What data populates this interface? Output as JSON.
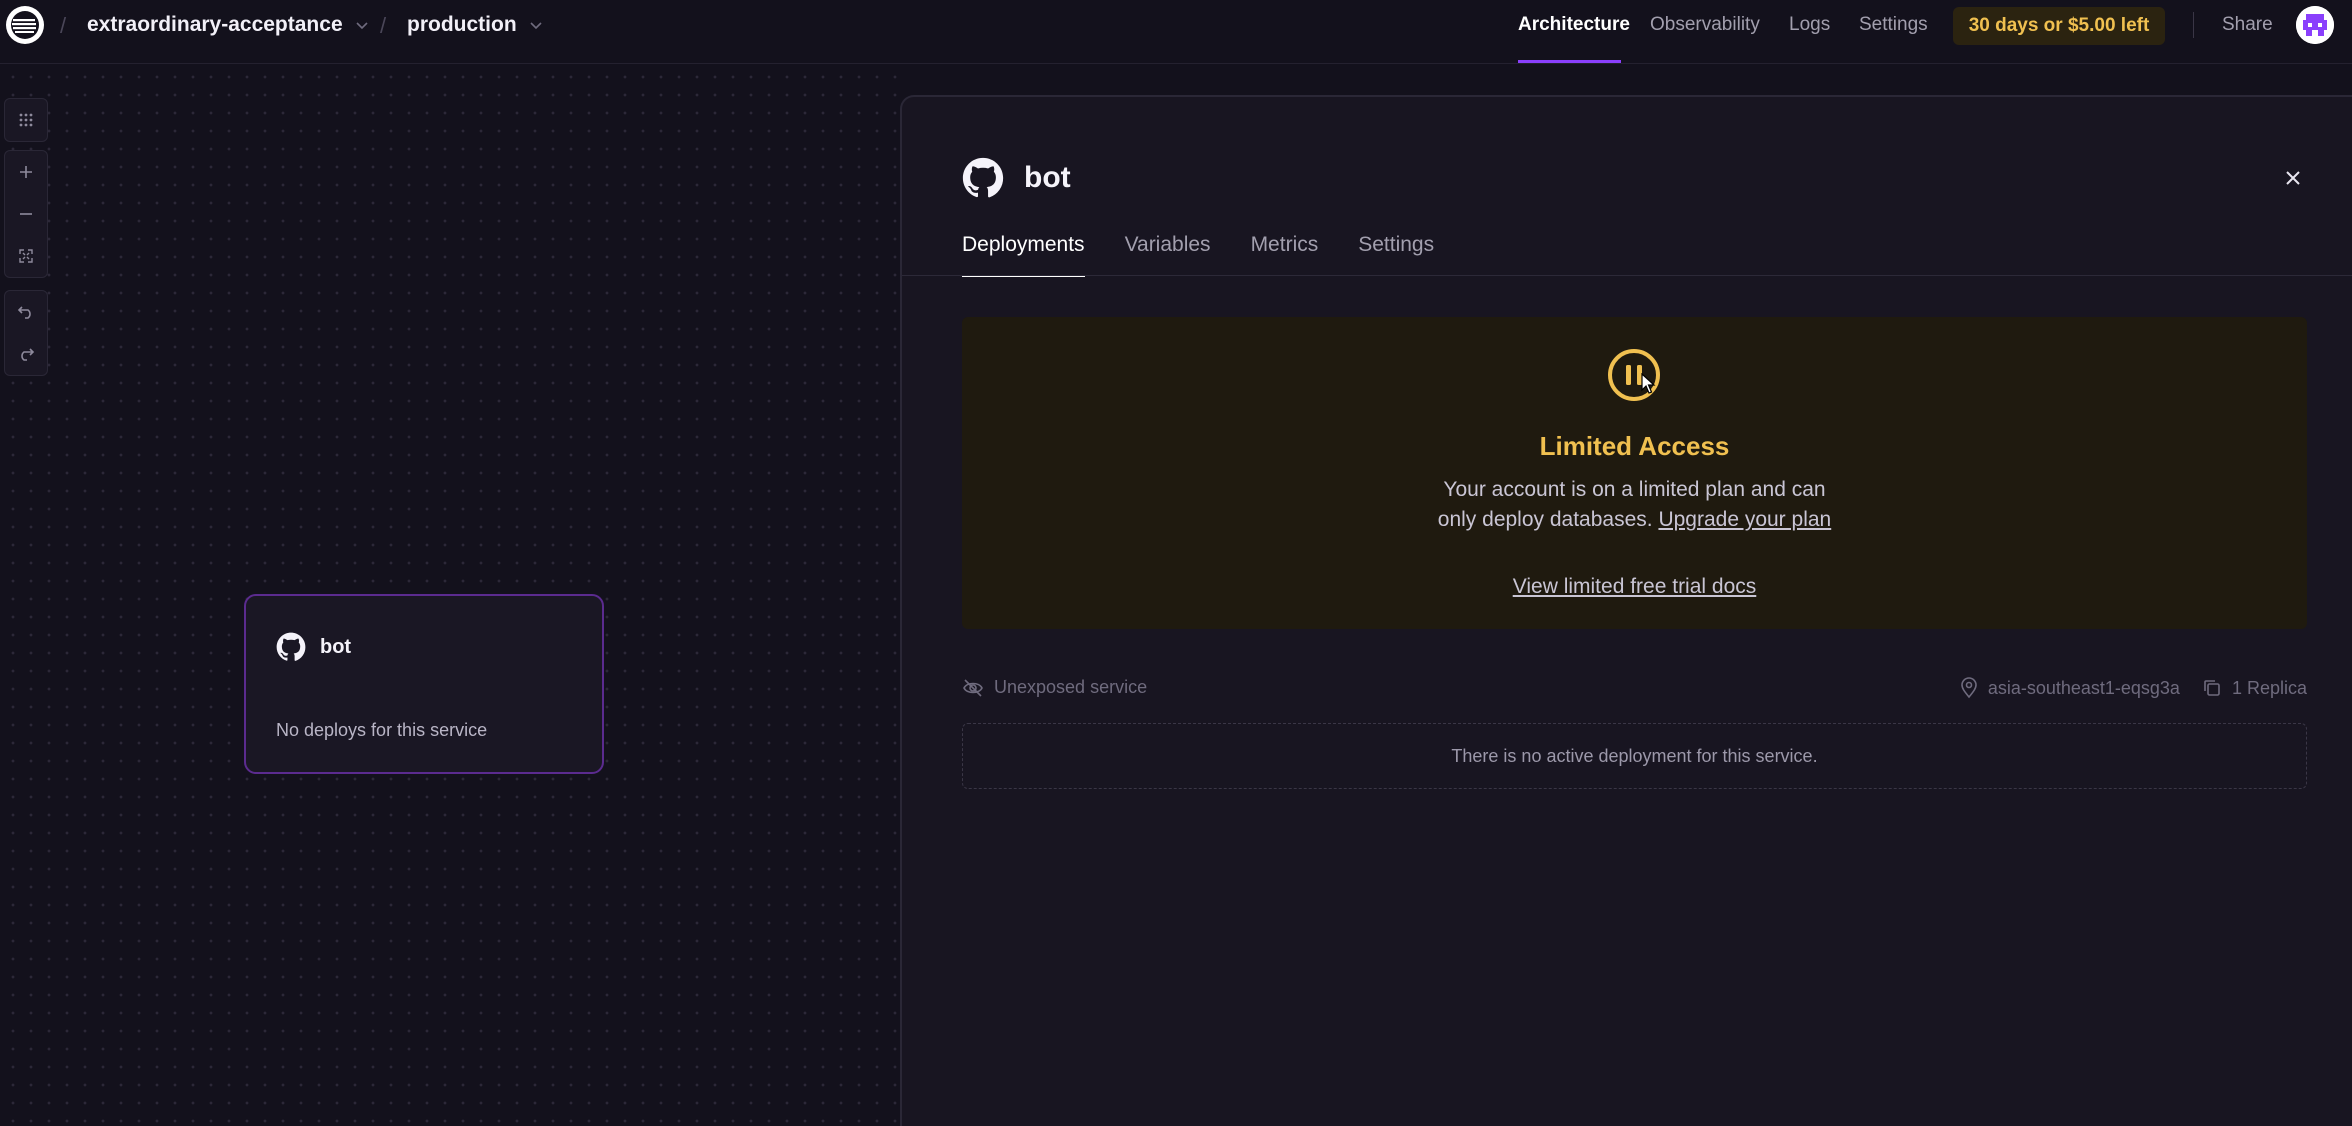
{
  "header": {
    "project_name": "extraordinary-acceptance",
    "environment": "production",
    "separator": "/",
    "nav": [
      {
        "label": "Architecture",
        "active": true
      },
      {
        "label": "Observability",
        "active": false
      },
      {
        "label": "Logs",
        "active": false
      },
      {
        "label": "Settings",
        "active": false
      }
    ],
    "trial_badge": "30 days or $5.00 left",
    "share_label": "Share"
  },
  "canvas": {
    "tools": [
      "grid-icon",
      "zoom-in-icon",
      "zoom-out-icon",
      "fit-view-icon",
      "undo-icon",
      "redo-icon"
    ],
    "service_card": {
      "title": "bot",
      "subtitle": "No deploys for this service",
      "icon": "github-icon"
    }
  },
  "panel": {
    "title": "bot",
    "tabs": [
      {
        "label": "Deployments",
        "active": true
      },
      {
        "label": "Variables",
        "active": false
      },
      {
        "label": "Metrics",
        "active": false
      },
      {
        "label": "Settings",
        "active": false
      }
    ],
    "limited": {
      "title": "Limited Access",
      "line1": "Your account is on a limited plan and can",
      "line2_prefix": "only deploy databases. ",
      "upgrade_link": "Upgrade your plan",
      "docs_link": "View limited free trial docs"
    },
    "exposure": "Unexposed service",
    "region": "asia-southeast1-eqsg3a",
    "replicas": "1 Replica",
    "empty_state": "There is no active deployment for this service."
  },
  "colors": {
    "accent": "#8a3ffc",
    "warning": "#f0c050",
    "background": "#13111c"
  }
}
